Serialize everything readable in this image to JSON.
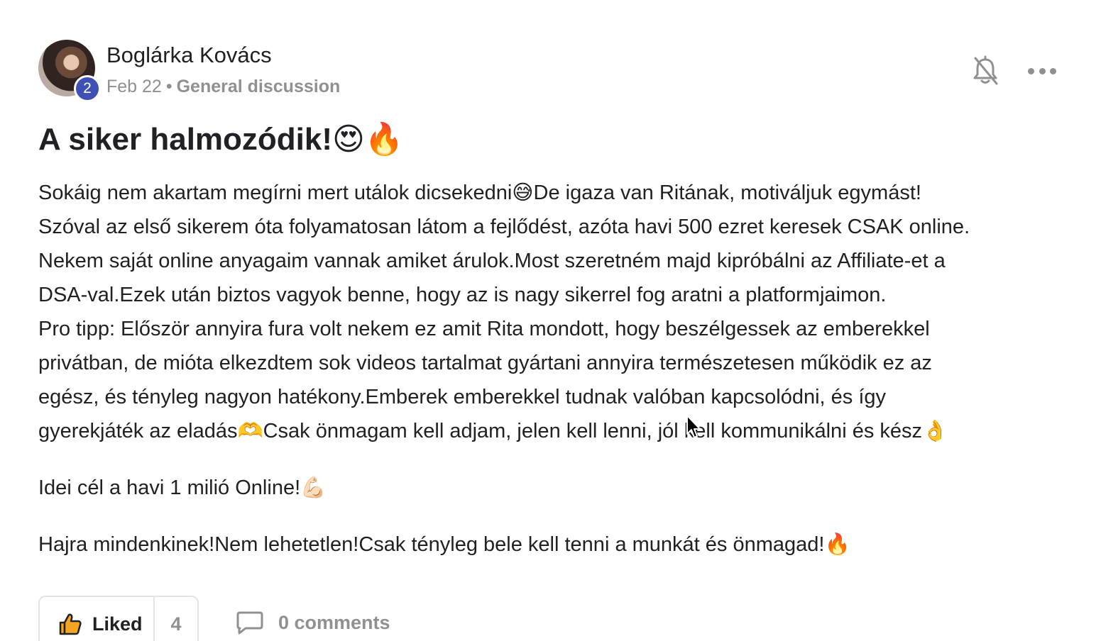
{
  "post": {
    "author": {
      "name": "Boglárka Kovács",
      "level": "2"
    },
    "meta": {
      "date": "Feb 22",
      "separator": "•",
      "category": "General discussion"
    },
    "title": "A siker halmozódik!😍🔥",
    "body": {
      "line1": "Sokáig nem akartam megírni mert utálok dicsekedni😅De igaza van Ritának, motiváljuk egymást!",
      "line2": "Szóval az első sikerem óta folyamatosan látom a fejlődést, azóta havi 500 ezret keresek CSAK online.",
      "line3": "Nekem saját online anyagaim vannak amiket árulok.Most szeretném majd kipróbálni az Affiliate-et a",
      "line4": "DSA-val.Ezek után biztos vagyok benne, hogy az is nagy sikerrel fog aratni a platformjaimon.",
      "line5": "Pro tipp: Először annyira fura volt nekem ez amit Rita mondott, hogy beszélgessek az emberekkel",
      "line6": "privátban, de mióta elkezdtem sok videos tartalmat gyártani annyira természetesen működik ez az",
      "line7": "egész, és tényleg nagyon hatékony.Emberek emberekkel tudnak valóban kapcsolódni, és így",
      "line8": "gyerekjáték az eladás🫶Csak önmagam kell adjam, jelen kell lenni, jól kell kommunikálni és kész👌",
      "goal": "Idei cél a havi 1 milió Online!💪🏻",
      "closing": "Hajra mindenkinek!Nem lehetetlen!Csak tényleg bele kell tenni a munkát és önmagad!🔥"
    },
    "actions": {
      "like_label": "Liked",
      "like_count": "4",
      "comments_label": "0 comments"
    },
    "icons": {
      "notification": "bell-off-icon",
      "menu": "more-horizontal-icon",
      "like": "thumbs-up-icon",
      "comment": "comment-icon"
    },
    "colors": {
      "level_badge": "#3f51b5",
      "muted_text": "#909090",
      "primary_text": "#202124"
    }
  }
}
